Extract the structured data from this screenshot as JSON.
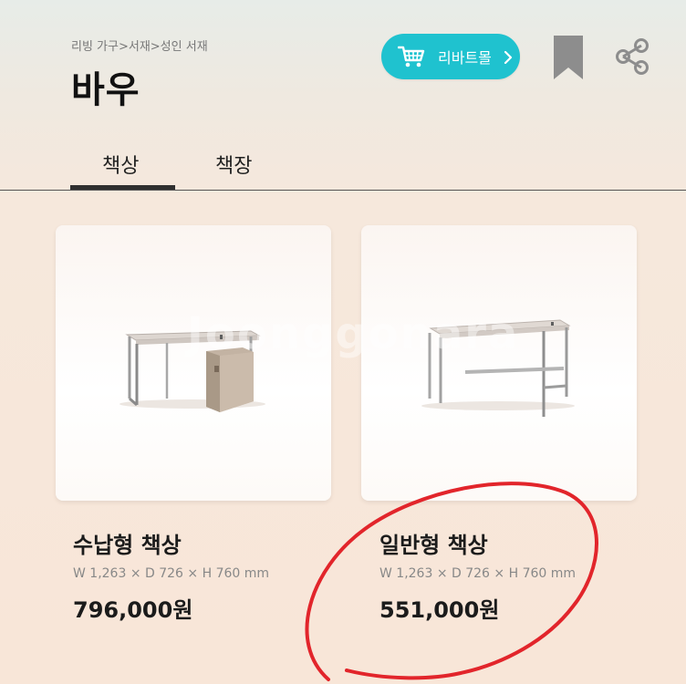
{
  "header": {
    "breadcrumb": "리빙 가구>서재>성인 서재",
    "title": "바우",
    "mall_button": {
      "label": "리바트몰",
      "icon": "cart-icon"
    },
    "bookmark_icon": "bookmark-icon",
    "share_icon": "share-icon"
  },
  "tabs": [
    {
      "label": "책상",
      "active": true
    },
    {
      "label": "책장",
      "active": false
    }
  ],
  "watermark": "Joonggonara",
  "products": [
    {
      "name": "수납형 책상",
      "dimensions": "W 1,263 × D 726 × H 760 mm",
      "price": "796,000원"
    },
    {
      "name": "일반형 책상",
      "dimensions": "W 1,263 × D 726 × H 760 mm",
      "price": "551,000원"
    }
  ],
  "colors": {
    "accent": "#1fc2cf",
    "annotation": "#e2252b",
    "tab_active": "#2f2f2f"
  }
}
